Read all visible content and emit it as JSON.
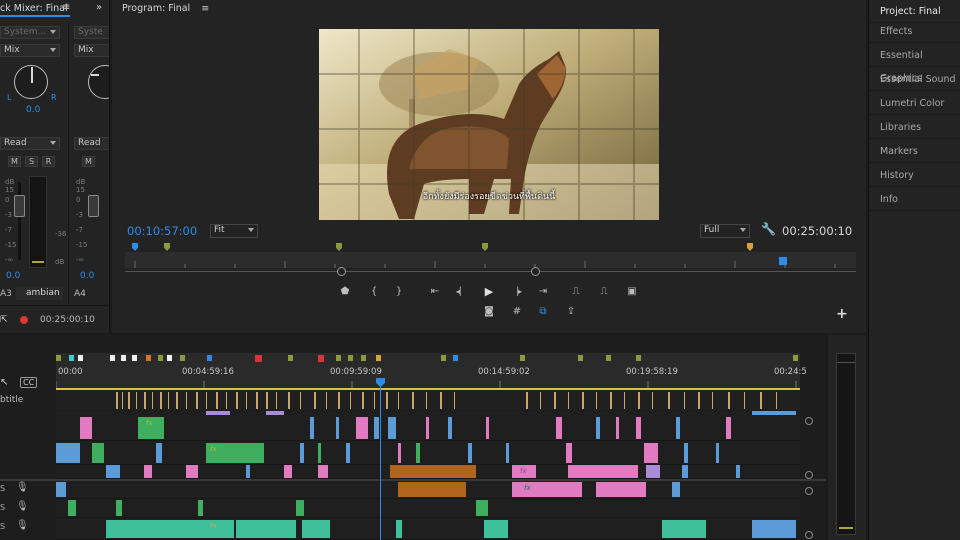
{
  "colors": {
    "accent": "#2d8ceb",
    "panel": "#232323",
    "clip_video": "#5c9bd6",
    "clip_pink": "#e07ac1",
    "clip_green": "#3fae5e",
    "clip_teal": "#3fbf9a",
    "clip_orange": "#b0651e",
    "clip_lavender": "#a98bd8"
  },
  "mixer": {
    "title": "ck Mixer: Final",
    "menu_icon": "hamburger-icon",
    "expand_icon": "double-chevron-right-icon",
    "channel1": {
      "input_placeholder": "System...",
      "mode": "Mix",
      "pan_left": "L",
      "pan_right": "R",
      "pan_value": "0.0",
      "automation": "Read",
      "m": "M",
      "s": "S",
      "r": "R",
      "db_label": "dB",
      "scale": [
        "15",
        "0",
        "-3",
        "-7",
        "-15",
        "-∞"
      ],
      "meter_scale": [
        "-36",
        "dB"
      ],
      "value": "0.0",
      "track": "A3",
      "name": "ambian"
    },
    "channel2": {
      "input_placeholder": "Syste",
      "mode": "Mix",
      "automation": "Read",
      "m": "M",
      "db_label": "dB",
      "scale": [
        "15",
        "0",
        "-3",
        "-7",
        "-15",
        "-∞"
      ],
      "value": "0.0",
      "track": "A4"
    },
    "footer_time": "00:25:00:10"
  },
  "program": {
    "title": "Program: Final",
    "menu_icon": "hamburger-icon",
    "subtitle": "อีกทั้งยังมีร่องรอยขีดข่วนที่พื้นดินนี้",
    "current_time": "00:10:57:00",
    "zoom": "Fit",
    "resolution": "Full",
    "duration": "00:25:00:10",
    "wrench_icon": "wrench-icon",
    "add_icon": "plus-icon",
    "transport": [
      {
        "name": "marker-icon",
        "glyph": "⬟"
      },
      {
        "name": "mark-in-icon",
        "glyph": "{"
      },
      {
        "name": "mark-out-icon",
        "glyph": "}"
      },
      {
        "name": "go-to-in-icon",
        "glyph": "⇤"
      },
      {
        "name": "step-back-icon",
        "glyph": "◂▏"
      },
      {
        "name": "play-icon",
        "glyph": "▶"
      },
      {
        "name": "step-forward-icon",
        "glyph": "▕▸"
      },
      {
        "name": "go-to-out-icon",
        "glyph": "⇥"
      },
      {
        "name": "lift-icon",
        "glyph": "⎍"
      },
      {
        "name": "extract-icon",
        "glyph": "⎍"
      },
      {
        "name": "comparison-view-icon",
        "glyph": "▣"
      }
    ],
    "tools": [
      {
        "name": "camera-icon",
        "glyph": "◙"
      },
      {
        "name": "safe-margins-icon",
        "glyph": "#"
      },
      {
        "name": "vr-video-icon",
        "glyph": "⧉"
      },
      {
        "name": "export-frame-icon",
        "glyph": "⇪"
      }
    ]
  },
  "right_panels": {
    "items": [
      "Project: Final",
      "Effects",
      "Essential Graphics",
      "Essential Sound",
      "Lumetri Color",
      "Libraries",
      "Markers",
      "History",
      "Info"
    ]
  },
  "timeline": {
    "ruler": [
      "00:00",
      "00:04:59:16",
      "00:09:59:09",
      "00:14:59:02",
      "00:19:58:19",
      "00:24:5"
    ],
    "subtitle_track_label": "btitle",
    "audio_track_letter": "S"
  }
}
